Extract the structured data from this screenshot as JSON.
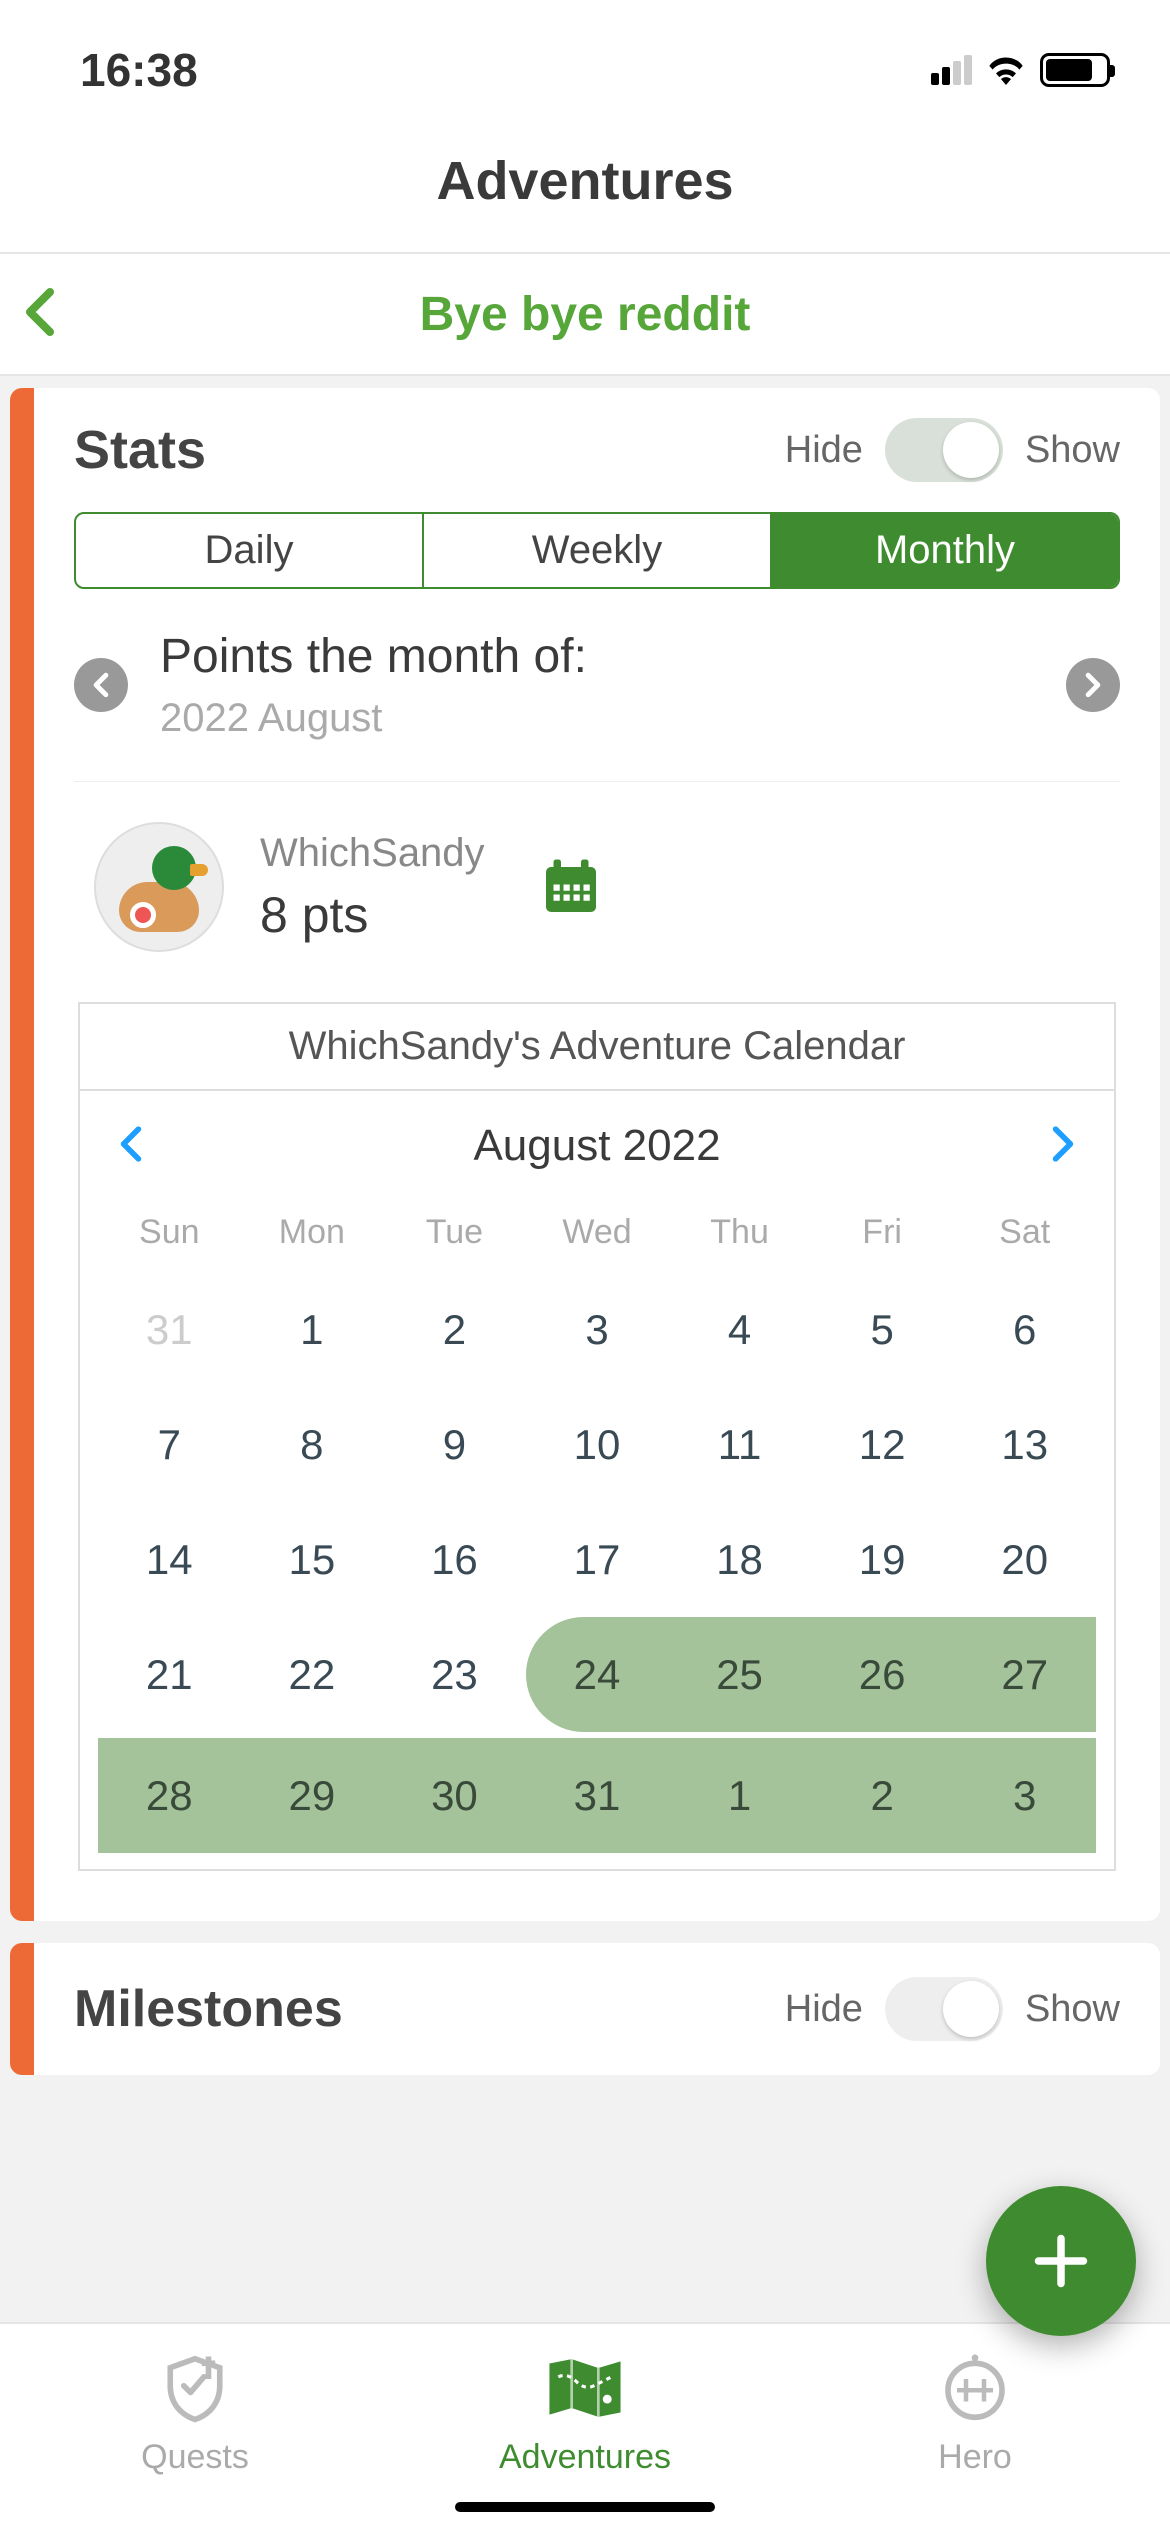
{
  "status_bar": {
    "time": "16:38"
  },
  "page_title": "Adventures",
  "sub_header": {
    "title": "Bye bye reddit"
  },
  "stats": {
    "title": "Stats",
    "hide_label": "Hide",
    "show_label": "Show",
    "toggle_state": "show",
    "segments": {
      "daily": "Daily",
      "weekly": "Weekly",
      "monthly": "Monthly",
      "active": "monthly"
    },
    "points_title": "Points the month of:",
    "month_label": "2022 August",
    "user": {
      "name": "WhichSandy",
      "points_label": "8 pts",
      "points": 8
    },
    "calendar": {
      "title": "WhichSandy's Adventure Calendar",
      "month_title": "August 2022",
      "day_headers": [
        "Sun",
        "Mon",
        "Tue",
        "Wed",
        "Thu",
        "Fri",
        "Sat"
      ],
      "weeks": [
        [
          {
            "n": "31",
            "faded": true
          },
          {
            "n": "1"
          },
          {
            "n": "2"
          },
          {
            "n": "3"
          },
          {
            "n": "4"
          },
          {
            "n": "5"
          },
          {
            "n": "6"
          }
        ],
        [
          {
            "n": "7"
          },
          {
            "n": "8"
          },
          {
            "n": "9"
          },
          {
            "n": "10"
          },
          {
            "n": "11"
          },
          {
            "n": "12"
          },
          {
            "n": "13"
          }
        ],
        [
          {
            "n": "14"
          },
          {
            "n": "15"
          },
          {
            "n": "16"
          },
          {
            "n": "17"
          },
          {
            "n": "18"
          },
          {
            "n": "19"
          },
          {
            "n": "20"
          }
        ],
        [
          {
            "n": "21"
          },
          {
            "n": "22"
          },
          {
            "n": "23"
          },
          {
            "n": "24",
            "hl": true,
            "start": true
          },
          {
            "n": "25",
            "hl": true
          },
          {
            "n": "26",
            "hl": true
          },
          {
            "n": "27",
            "hl": true
          }
        ],
        [
          {
            "n": "28",
            "hl": true
          },
          {
            "n": "29",
            "hl": true
          },
          {
            "n": "30",
            "hl": true
          },
          {
            "n": "31",
            "hl": true
          },
          {
            "n": "1",
            "hl": true
          },
          {
            "n": "2",
            "hl": true
          },
          {
            "n": "3",
            "hl": true
          }
        ]
      ]
    }
  },
  "milestones": {
    "title": "Milestones",
    "hide_label": "Hide",
    "show_label": "Show",
    "toggle_state": "show"
  },
  "tab_bar": {
    "items": [
      {
        "id": "quests",
        "label": "Quests"
      },
      {
        "id": "adventures",
        "label": "Adventures"
      },
      {
        "id": "hero",
        "label": "Hero"
      }
    ],
    "active": "adventures"
  }
}
